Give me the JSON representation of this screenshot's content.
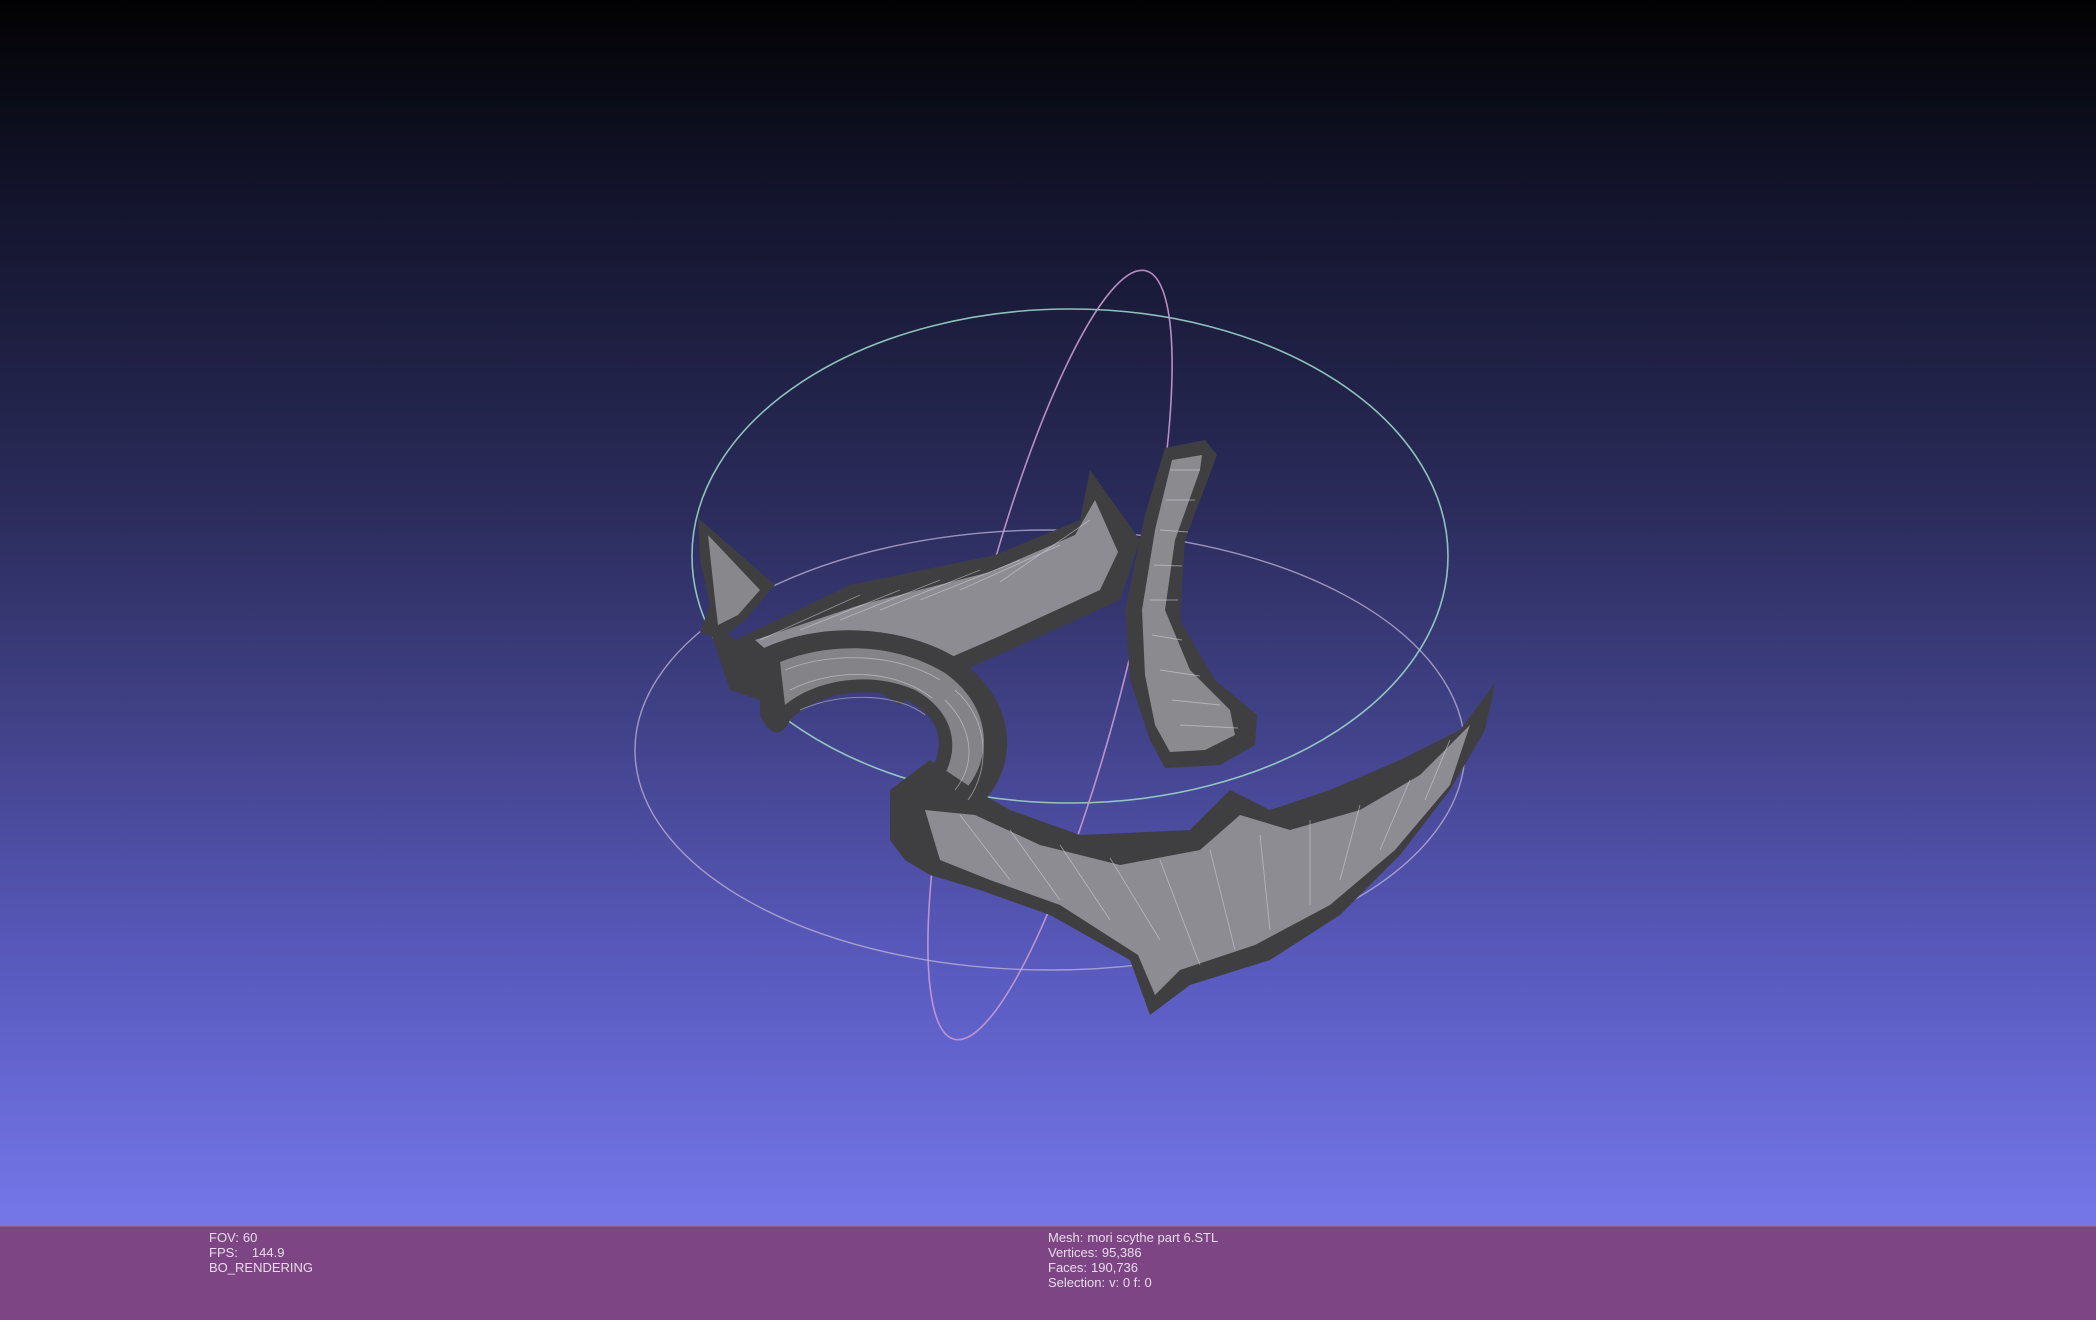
{
  "viewer": {
    "background_top": "#020203",
    "background_bottom": "#7476e8",
    "status_bar_color": "#7d4584",
    "mesh_color": "#6b6b6b",
    "trackball_colors": [
      "#9ad3c8",
      "#c99ad0",
      "#bfb6d7"
    ]
  },
  "status": {
    "fov_label": "FOV:",
    "fov_value": "60",
    "fps_label": "FPS:",
    "fps_value": "144.9",
    "render_mode": "BO_RENDERING",
    "mesh_label": "Mesh:",
    "mesh_name": "mori scythe part 6.STL",
    "vertices_label": "Vertices:",
    "vertices_value": "95,386",
    "faces_label": "Faces:",
    "faces_value": "190,736",
    "selection_label": "Selection:",
    "selection_value": "v: 0 f: 0"
  }
}
